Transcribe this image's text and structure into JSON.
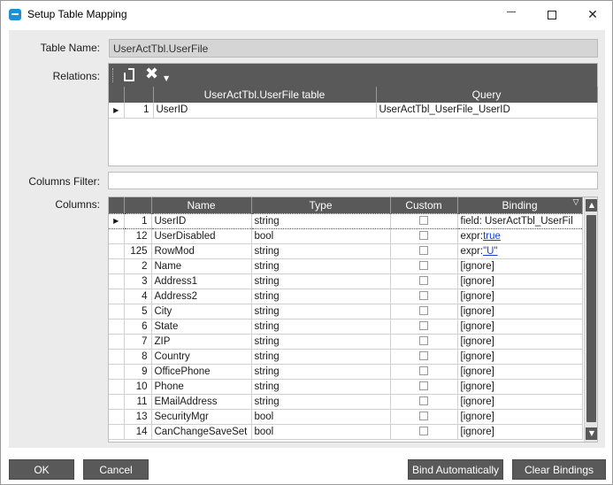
{
  "window": {
    "title": "Setup Table Mapping",
    "controls": {
      "minimize": "—",
      "maximize": "☐",
      "close": "✕"
    }
  },
  "form": {
    "table_name_label": "Table Name:",
    "table_name_value": "UserActTbl.UserFile",
    "relations_label": "Relations:",
    "columns_filter_label": "Columns Filter:",
    "columns_filter_value": "",
    "columns_label": "Columns:"
  },
  "relations": {
    "toolbar": {
      "new_icon": "new-document-icon",
      "delete_icon": "delete-icon",
      "delete_glyph": "✖",
      "dropdown_glyph": "▼"
    },
    "headers": [
      "",
      "",
      "UserActTbl.UserFile table",
      "Query"
    ],
    "rows": [
      {
        "indicator": "▶",
        "num": "1",
        "table": "UserID",
        "query": "UserActTbl_UserFile_UserID"
      }
    ]
  },
  "columns": {
    "headers": {
      "indicator": "",
      "num": "",
      "name": "Name",
      "type": "Type",
      "custom": "Custom",
      "binding": "Binding"
    },
    "rows": [
      {
        "indicator": "▶",
        "num": "1",
        "name": "UserID",
        "type": "string",
        "custom": false,
        "binding_prefix": "field: UserActTbl_UserFil",
        "binding_link": ""
      },
      {
        "indicator": "",
        "num": "12",
        "name": "UserDisabled",
        "type": "bool",
        "custom": false,
        "binding_prefix": "expr:",
        "binding_link": "true"
      },
      {
        "indicator": "",
        "num": "125",
        "name": "RowMod",
        "type": "string",
        "custom": false,
        "binding_prefix": "expr:",
        "binding_link": "\"U\""
      },
      {
        "indicator": "",
        "num": "2",
        "name": "Name",
        "type": "string",
        "custom": false,
        "binding_prefix": "[ignore]",
        "binding_link": ""
      },
      {
        "indicator": "",
        "num": "3",
        "name": "Address1",
        "type": "string",
        "custom": false,
        "binding_prefix": "[ignore]",
        "binding_link": ""
      },
      {
        "indicator": "",
        "num": "4",
        "name": "Address2",
        "type": "string",
        "custom": false,
        "binding_prefix": "[ignore]",
        "binding_link": ""
      },
      {
        "indicator": "",
        "num": "5",
        "name": "City",
        "type": "string",
        "custom": false,
        "binding_prefix": "[ignore]",
        "binding_link": ""
      },
      {
        "indicator": "",
        "num": "6",
        "name": "State",
        "type": "string",
        "custom": false,
        "binding_prefix": "[ignore]",
        "binding_link": ""
      },
      {
        "indicator": "",
        "num": "7",
        "name": "ZIP",
        "type": "string",
        "custom": false,
        "binding_prefix": "[ignore]",
        "binding_link": ""
      },
      {
        "indicator": "",
        "num": "8",
        "name": "Country",
        "type": "string",
        "custom": false,
        "binding_prefix": "[ignore]",
        "binding_link": ""
      },
      {
        "indicator": "",
        "num": "9",
        "name": "OfficePhone",
        "type": "string",
        "custom": false,
        "binding_prefix": "[ignore]",
        "binding_link": ""
      },
      {
        "indicator": "",
        "num": "10",
        "name": "Phone",
        "type": "string",
        "custom": false,
        "binding_prefix": "[ignore]",
        "binding_link": ""
      },
      {
        "indicator": "",
        "num": "11",
        "name": "EMailAddress",
        "type": "string",
        "custom": false,
        "binding_prefix": "[ignore]",
        "binding_link": ""
      },
      {
        "indicator": "",
        "num": "13",
        "name": "SecurityMgr",
        "type": "bool",
        "custom": false,
        "binding_prefix": "[ignore]",
        "binding_link": ""
      },
      {
        "indicator": "",
        "num": "14",
        "name": "CanChangeSaveSet",
        "type": "bool",
        "custom": false,
        "binding_prefix": "[ignore]",
        "binding_link": ""
      }
    ],
    "filter_glyph": "▽",
    "scroll_up_glyph": "▲",
    "scroll_down_glyph": "▼"
  },
  "buttons": {
    "ok": "OK",
    "cancel": "Cancel",
    "bind_automatically": "Bind Automatically",
    "clear_bindings": "Clear Bindings"
  },
  "colors": {
    "header_bg": "#595959",
    "accent_icon": "#1e90d6",
    "link": "#1a3fd6",
    "panel_bg": "#ebebeb"
  }
}
